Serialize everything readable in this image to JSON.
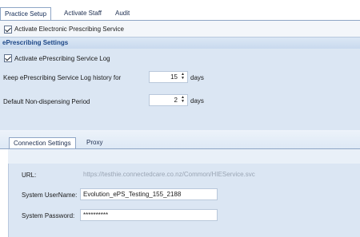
{
  "top_tabs": [
    {
      "label": "Practice Setup",
      "active": true
    },
    {
      "label": "Activate Staff",
      "active": false
    },
    {
      "label": "Audit",
      "active": false
    }
  ],
  "practice": {
    "electronic_prescribing_label": "Activate Electronic Prescribing Service",
    "electronic_prescribing_checked": true
  },
  "eprescribing": {
    "header": "ePrescribing Settings",
    "log_label": "Activate ePrescribing Service Log",
    "log_checked": true,
    "history_label": "Keep ePrescribing Service Log history for",
    "history_value": "15",
    "history_unit": "days",
    "nondispensing_label": "Default Non-dispensing Period",
    "nondispensing_value": "2",
    "nondispensing_unit": "days"
  },
  "bottom_tabs": [
    {
      "label": "Connection Settings",
      "active": true
    },
    {
      "label": "Proxy",
      "active": false
    }
  ],
  "connection": {
    "url_label": "URL:",
    "url_value": "https://testhie.connectedcare.co.nz/Common/HIEService.svc",
    "username_label": "System UserName:",
    "username_value": "Evolution_ePS_Testing_155_2188",
    "password_label": "System Password:",
    "password_value": "**********"
  },
  "colors": {
    "panel_bg": "#dbe6f3",
    "header_text": "#1d4787",
    "border": "#8fa6c6"
  }
}
